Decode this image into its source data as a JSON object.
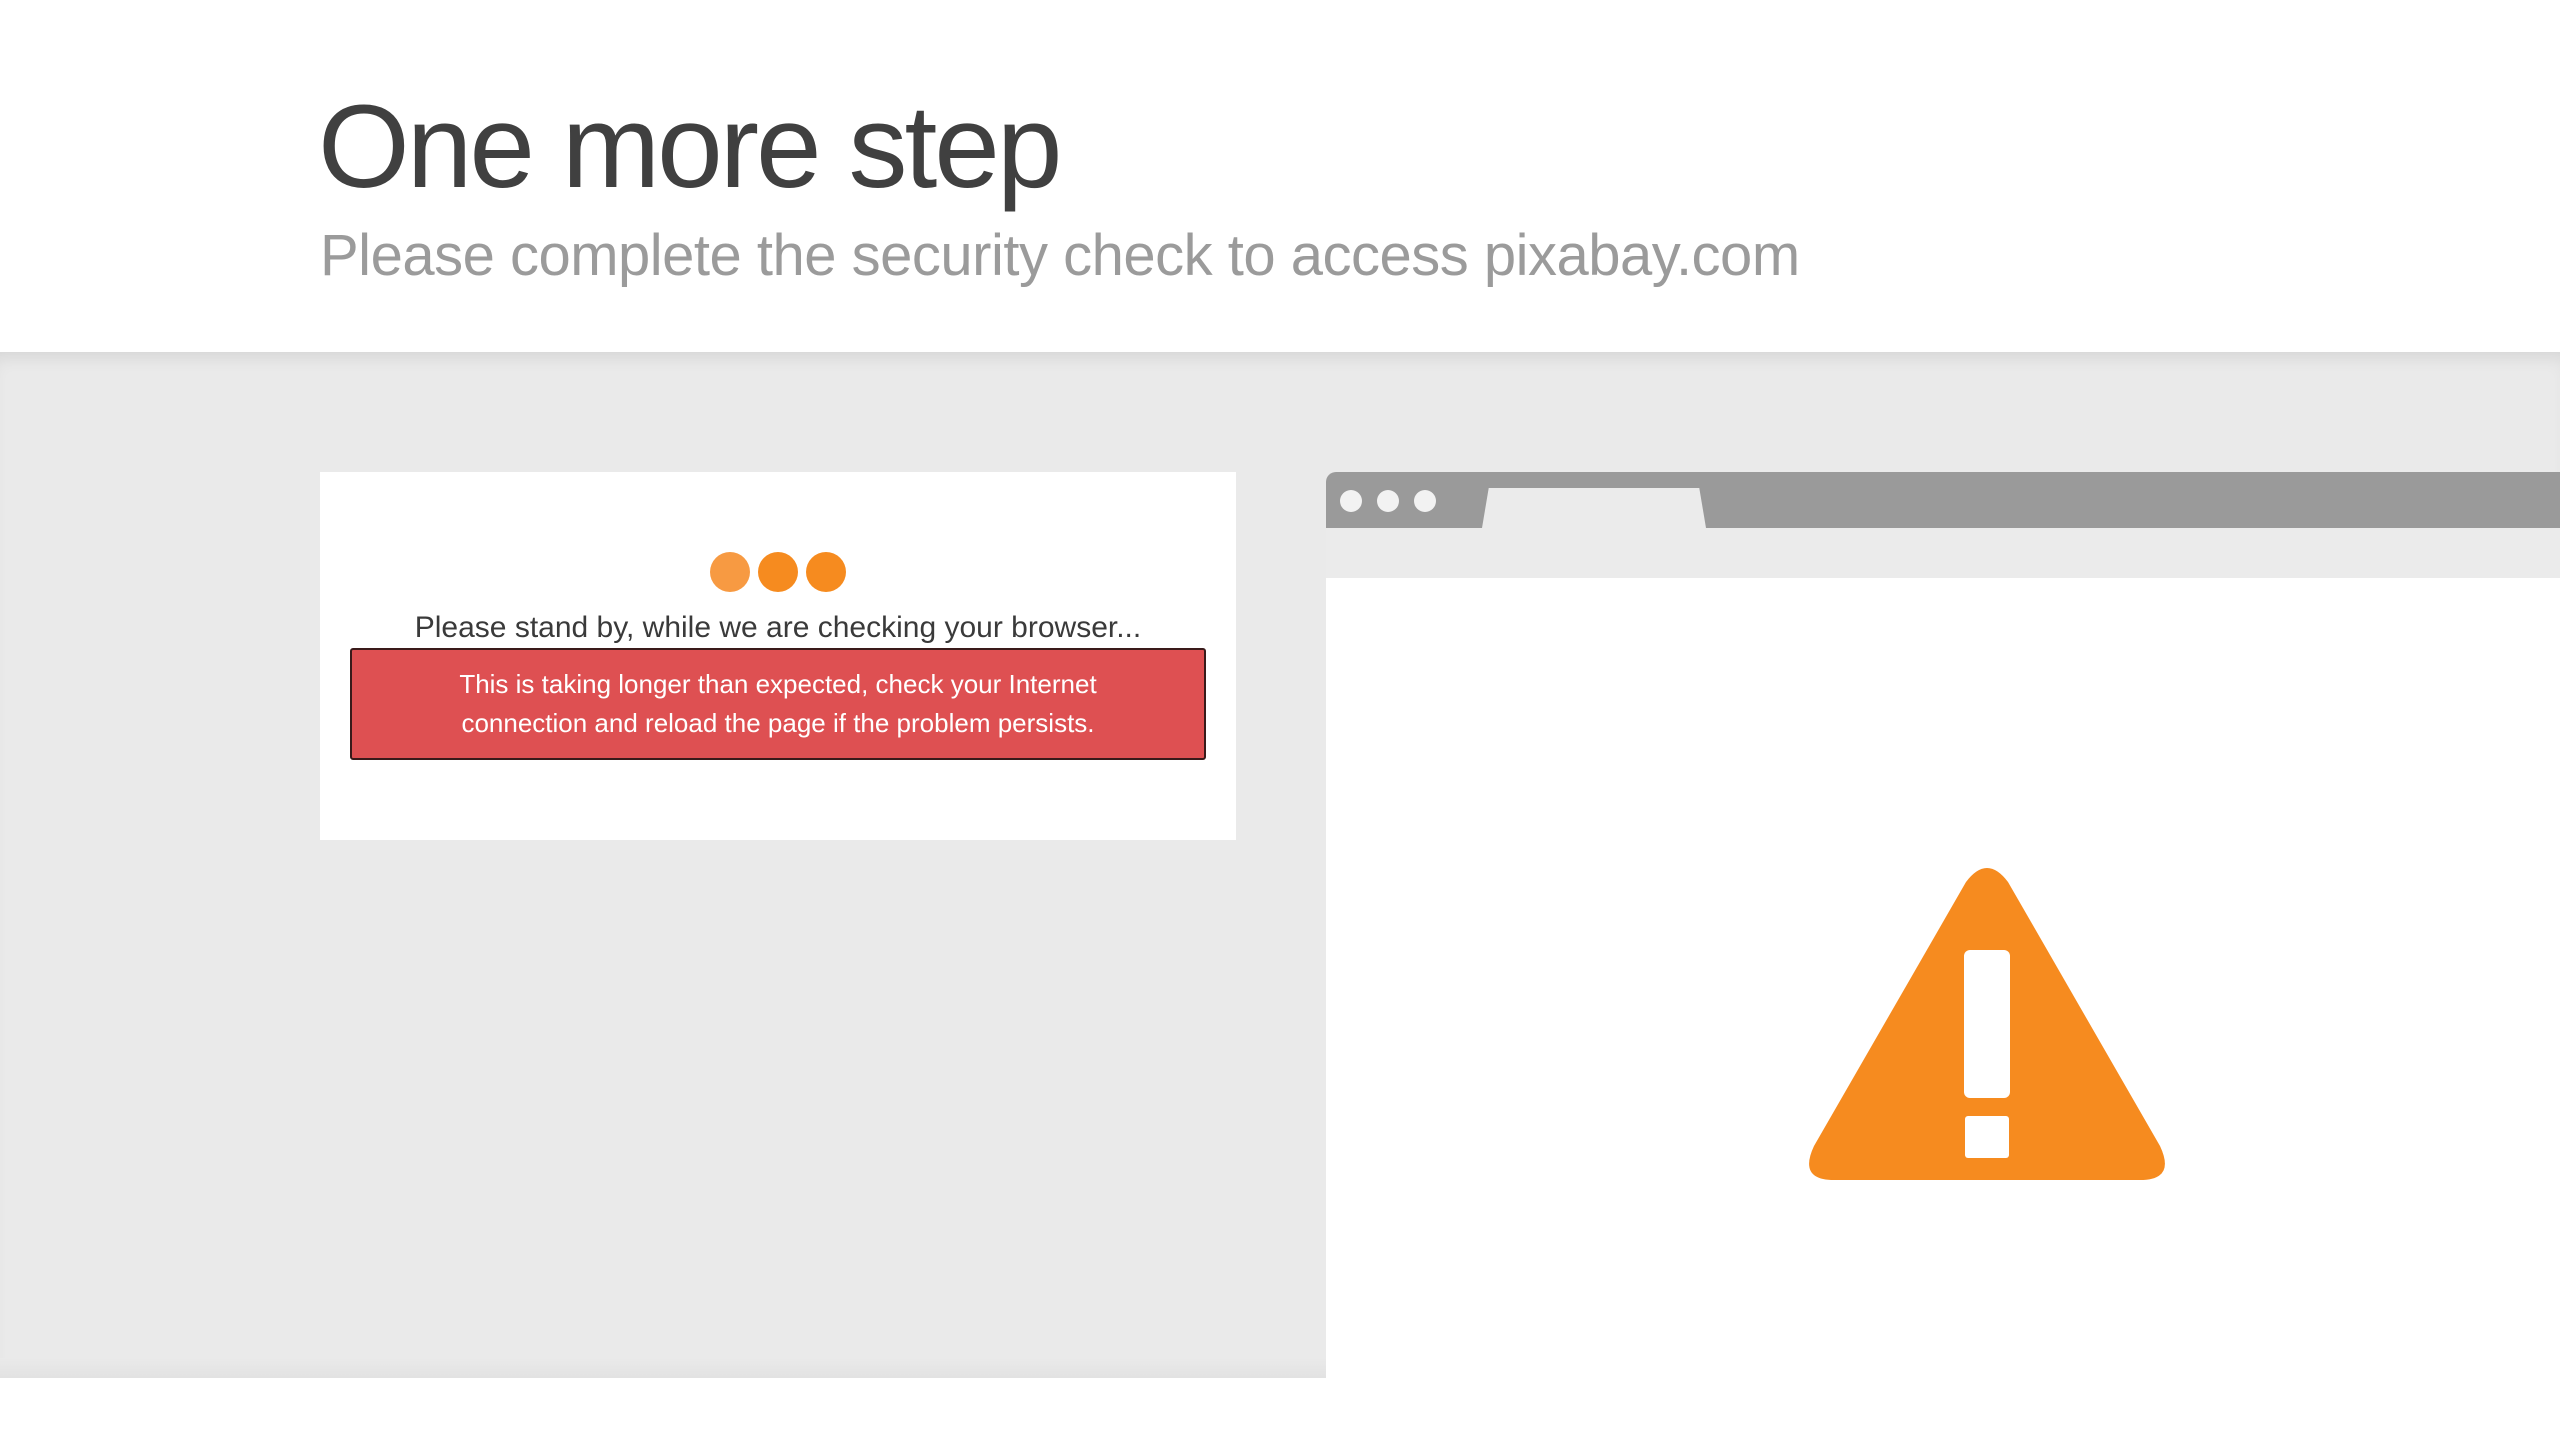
{
  "header": {
    "title": "One more step",
    "subtitle": "Please complete the security check to access pixabay.com"
  },
  "check_card": {
    "standby_text": "Please stand by, while we are checking your browser...",
    "error_message_line1": "This is taking longer than expected, check your Internet",
    "error_message_line2": "connection and reload the page if the problem persists."
  },
  "illustration": {
    "icon": "warning-icon",
    "window_controls_icon": "window-dots-icon",
    "loading_icon": "loading-dots-icon"
  },
  "colors": {
    "accent_orange": "#f68b1f",
    "error_red": "#de5052",
    "band_grey": "#eaeaea",
    "browser_bar_grey": "#9a9a9a"
  }
}
